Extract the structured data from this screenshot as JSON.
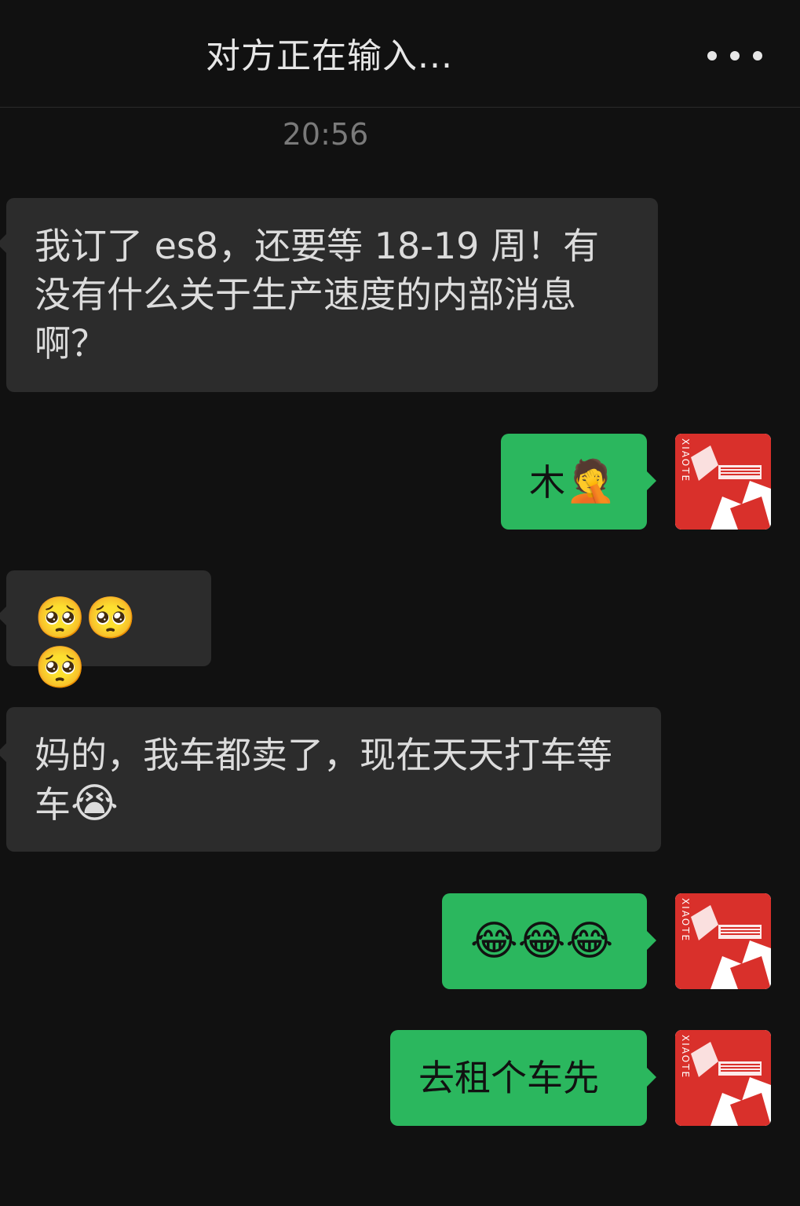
{
  "header": {
    "title": "对方正在输入...",
    "more_icon": "more-dots-icon"
  },
  "timestamp": "20:56",
  "messages": [
    {
      "side": "incoming",
      "text": "我订了 es8，还要等 18-19 周！有没有什么关于生产速度的内部消息啊？"
    },
    {
      "side": "outgoing",
      "text": "木",
      "emoji": "🤦"
    },
    {
      "side": "incoming",
      "text": "",
      "emoji": "🥺🥺🥺"
    },
    {
      "side": "incoming",
      "text": "妈的，我车都卖了，现在天天打车等车",
      "emoji": "😭"
    },
    {
      "side": "outgoing",
      "text": "",
      "emoji": "😂😂😂"
    },
    {
      "side": "outgoing",
      "text": "去租个车先"
    }
  ],
  "avatar": {
    "brand_text": "XIAOTE",
    "colors": {
      "primary": "#d9302b",
      "background": "#ffffff"
    }
  },
  "colors": {
    "background": "#111111",
    "incoming_bubble": "#2c2c2c",
    "outgoing_bubble": "#2bb75e"
  }
}
